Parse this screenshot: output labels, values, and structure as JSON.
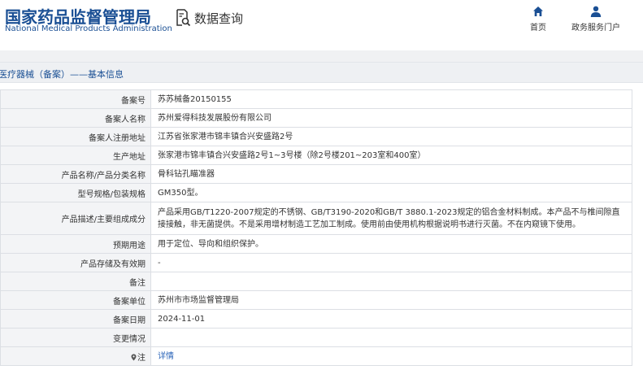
{
  "header": {
    "logo_cn": "国家药品监督管理局",
    "logo_en": "National Medical Products Administration",
    "query_label": "数据查询",
    "nav": [
      {
        "label": "首页",
        "icon": "home-icon"
      },
      {
        "label": "政务服务门户",
        "icon": "user-icon"
      }
    ]
  },
  "breadcrumb": "医疗器械（备案）——基本信息",
  "rows": [
    {
      "label": "备案号",
      "value": "苏苏械备20150155"
    },
    {
      "label": "备案人名称",
      "value": "苏州爱得科技发展股份有限公司"
    },
    {
      "label": "备案人注册地址",
      "value": "江苏省张家港市锦丰镇合兴安盛路2号"
    },
    {
      "label": "生产地址",
      "value": "张家港市锦丰镇合兴安盛路2号1~3号楼（除2号楼201~203室和400室）"
    },
    {
      "label": "产品名称/产品分类名称",
      "value": "骨科钻孔瞄准器"
    },
    {
      "label": "型号规格/包装规格",
      "value": "GM350型。"
    },
    {
      "label": "产品描述/主要组成成分",
      "value": "产品采用GB/T1220-2007规定的不锈钢、GB/T3190-2020和GB/T 3880.1-2023规定的铝合金材料制成。本产品不与椎间隙直接接触，非无菌提供。不是采用增材制造工艺加工制成。使用前由使用机构根据说明书进行灭菌。不在内窥镜下使用。"
    },
    {
      "label": "预期用途",
      "value": "用于定位、导向和组织保护。"
    },
    {
      "label": "产品存储及有效期",
      "value": "-"
    },
    {
      "label": "备注",
      "value": ""
    },
    {
      "label": "备案单位",
      "value": "苏州市市场监督管理局"
    },
    {
      "label": "备案日期",
      "value": "2024-11-01"
    },
    {
      "label": "变更情况",
      "value": ""
    },
    {
      "label": "注",
      "value": "详情"
    }
  ],
  "colors": {
    "brand": "#1a4f94",
    "link": "#2a64b8",
    "label_bg": "#f3f4f6",
    "border": "#dcdfe4"
  }
}
